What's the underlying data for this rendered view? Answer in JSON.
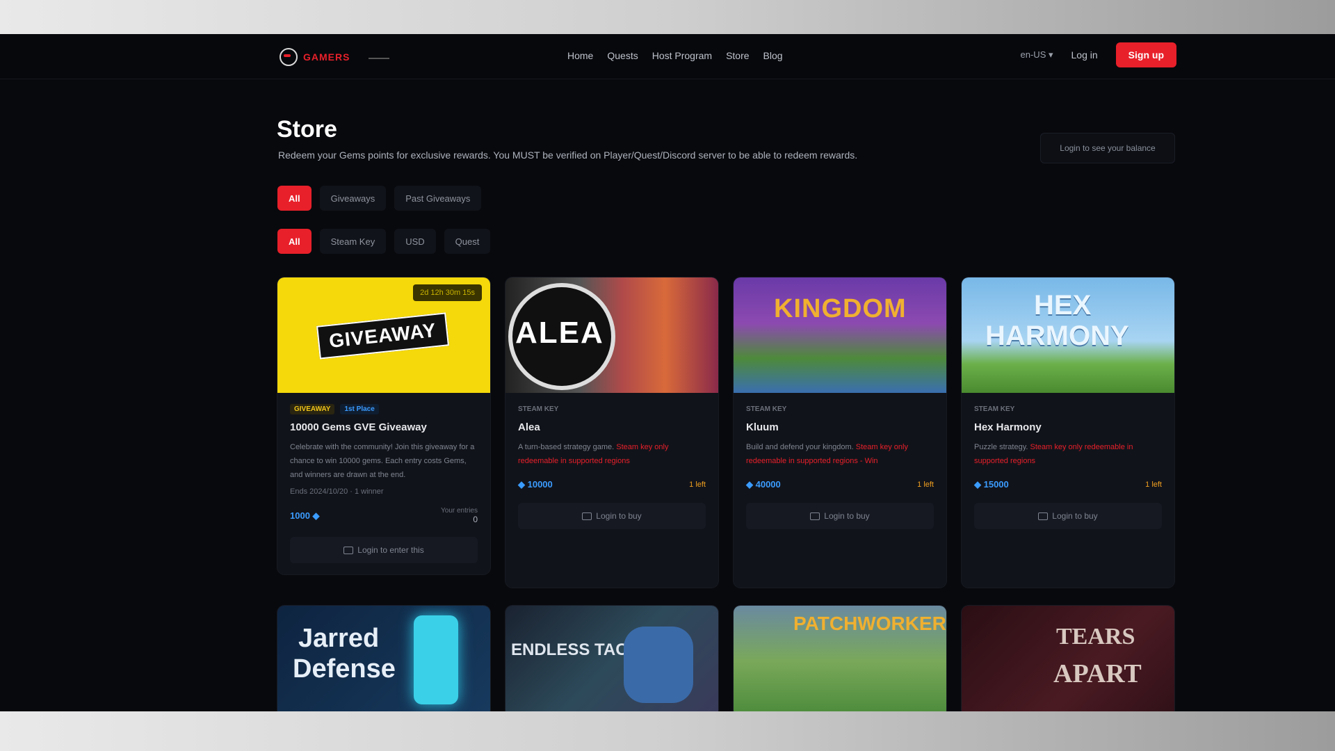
{
  "header": {
    "logo_text": "GAMERS",
    "nav": [
      "Home",
      "Quests",
      "Host Program",
      "Store",
      "Blog"
    ],
    "lang": "en-US ▾",
    "login": "Log in",
    "signup": "Sign up"
  },
  "page": {
    "title": "Store",
    "subtitle": "Redeem your Gems points for exclusive rewards. You MUST be verified on Player/Quest/Discord server to be able to redeem rewards.",
    "ghost_button": "Login to see your balance"
  },
  "filters": {
    "row1": [
      "All",
      "Giveaways",
      "Past Giveaways"
    ],
    "row2": [
      "All",
      "Steam Key",
      "USD",
      "Quest"
    ],
    "active_index": 0
  },
  "cards": [
    {
      "art_text": "GIVEAWAY",
      "countdown": "2d 12h 30m 15s",
      "tags": [
        "GIVEAWAY",
        "1st Place"
      ],
      "title": "10000 Gems GVE Giveaway",
      "desc": "Celebrate with the community! Join this giveaway for a chance to win 10000 gems. Each entry costs Gems, and winners are drawn at the end.",
      "meta": "Ends 2024/10/20 · 1 winner",
      "price": "1000 ◆",
      "entries_label": "Your entries",
      "entries_value": "0",
      "button": "Login to enter this"
    },
    {
      "art_text": "ALEA",
      "tags": [
        "STEAM KEY"
      ],
      "title": "Alea",
      "desc_plain": "A turn-based strategy game. ",
      "desc_red": "Steam key only redeemable in supported regions",
      "price": "◆ 10000",
      "stock": "1 left",
      "button": "Login to buy"
    },
    {
      "art_text": "KINGDOM",
      "tags": [
        "STEAM KEY"
      ],
      "title": "Kluum",
      "desc_plain": "Build and defend your kingdom. ",
      "desc_red": "Steam key only redeemable in supported regions - Win",
      "price": "◆ 40000",
      "stock": "1 left",
      "button": "Login to buy"
    },
    {
      "art_text_1": "HEX",
      "art_text_2": "HARMONY",
      "tags": [
        "STEAM KEY"
      ],
      "title": "Hex Harmony",
      "desc_plain": "Puzzle strategy. ",
      "desc_red": "Steam key only redeemable in supported regions",
      "price": "◆ 15000",
      "stock": "1 left",
      "button": "Login to buy"
    }
  ],
  "row2_cards": [
    {
      "art_text_1": "Jarred",
      "art_text_2": "Defense"
    },
    {
      "art_text": "ENDLESS TACTICS"
    },
    {
      "art_text": "PATCHWORKER"
    },
    {
      "art_text_1": "TEARS",
      "art_text_2": "APART"
    }
  ]
}
